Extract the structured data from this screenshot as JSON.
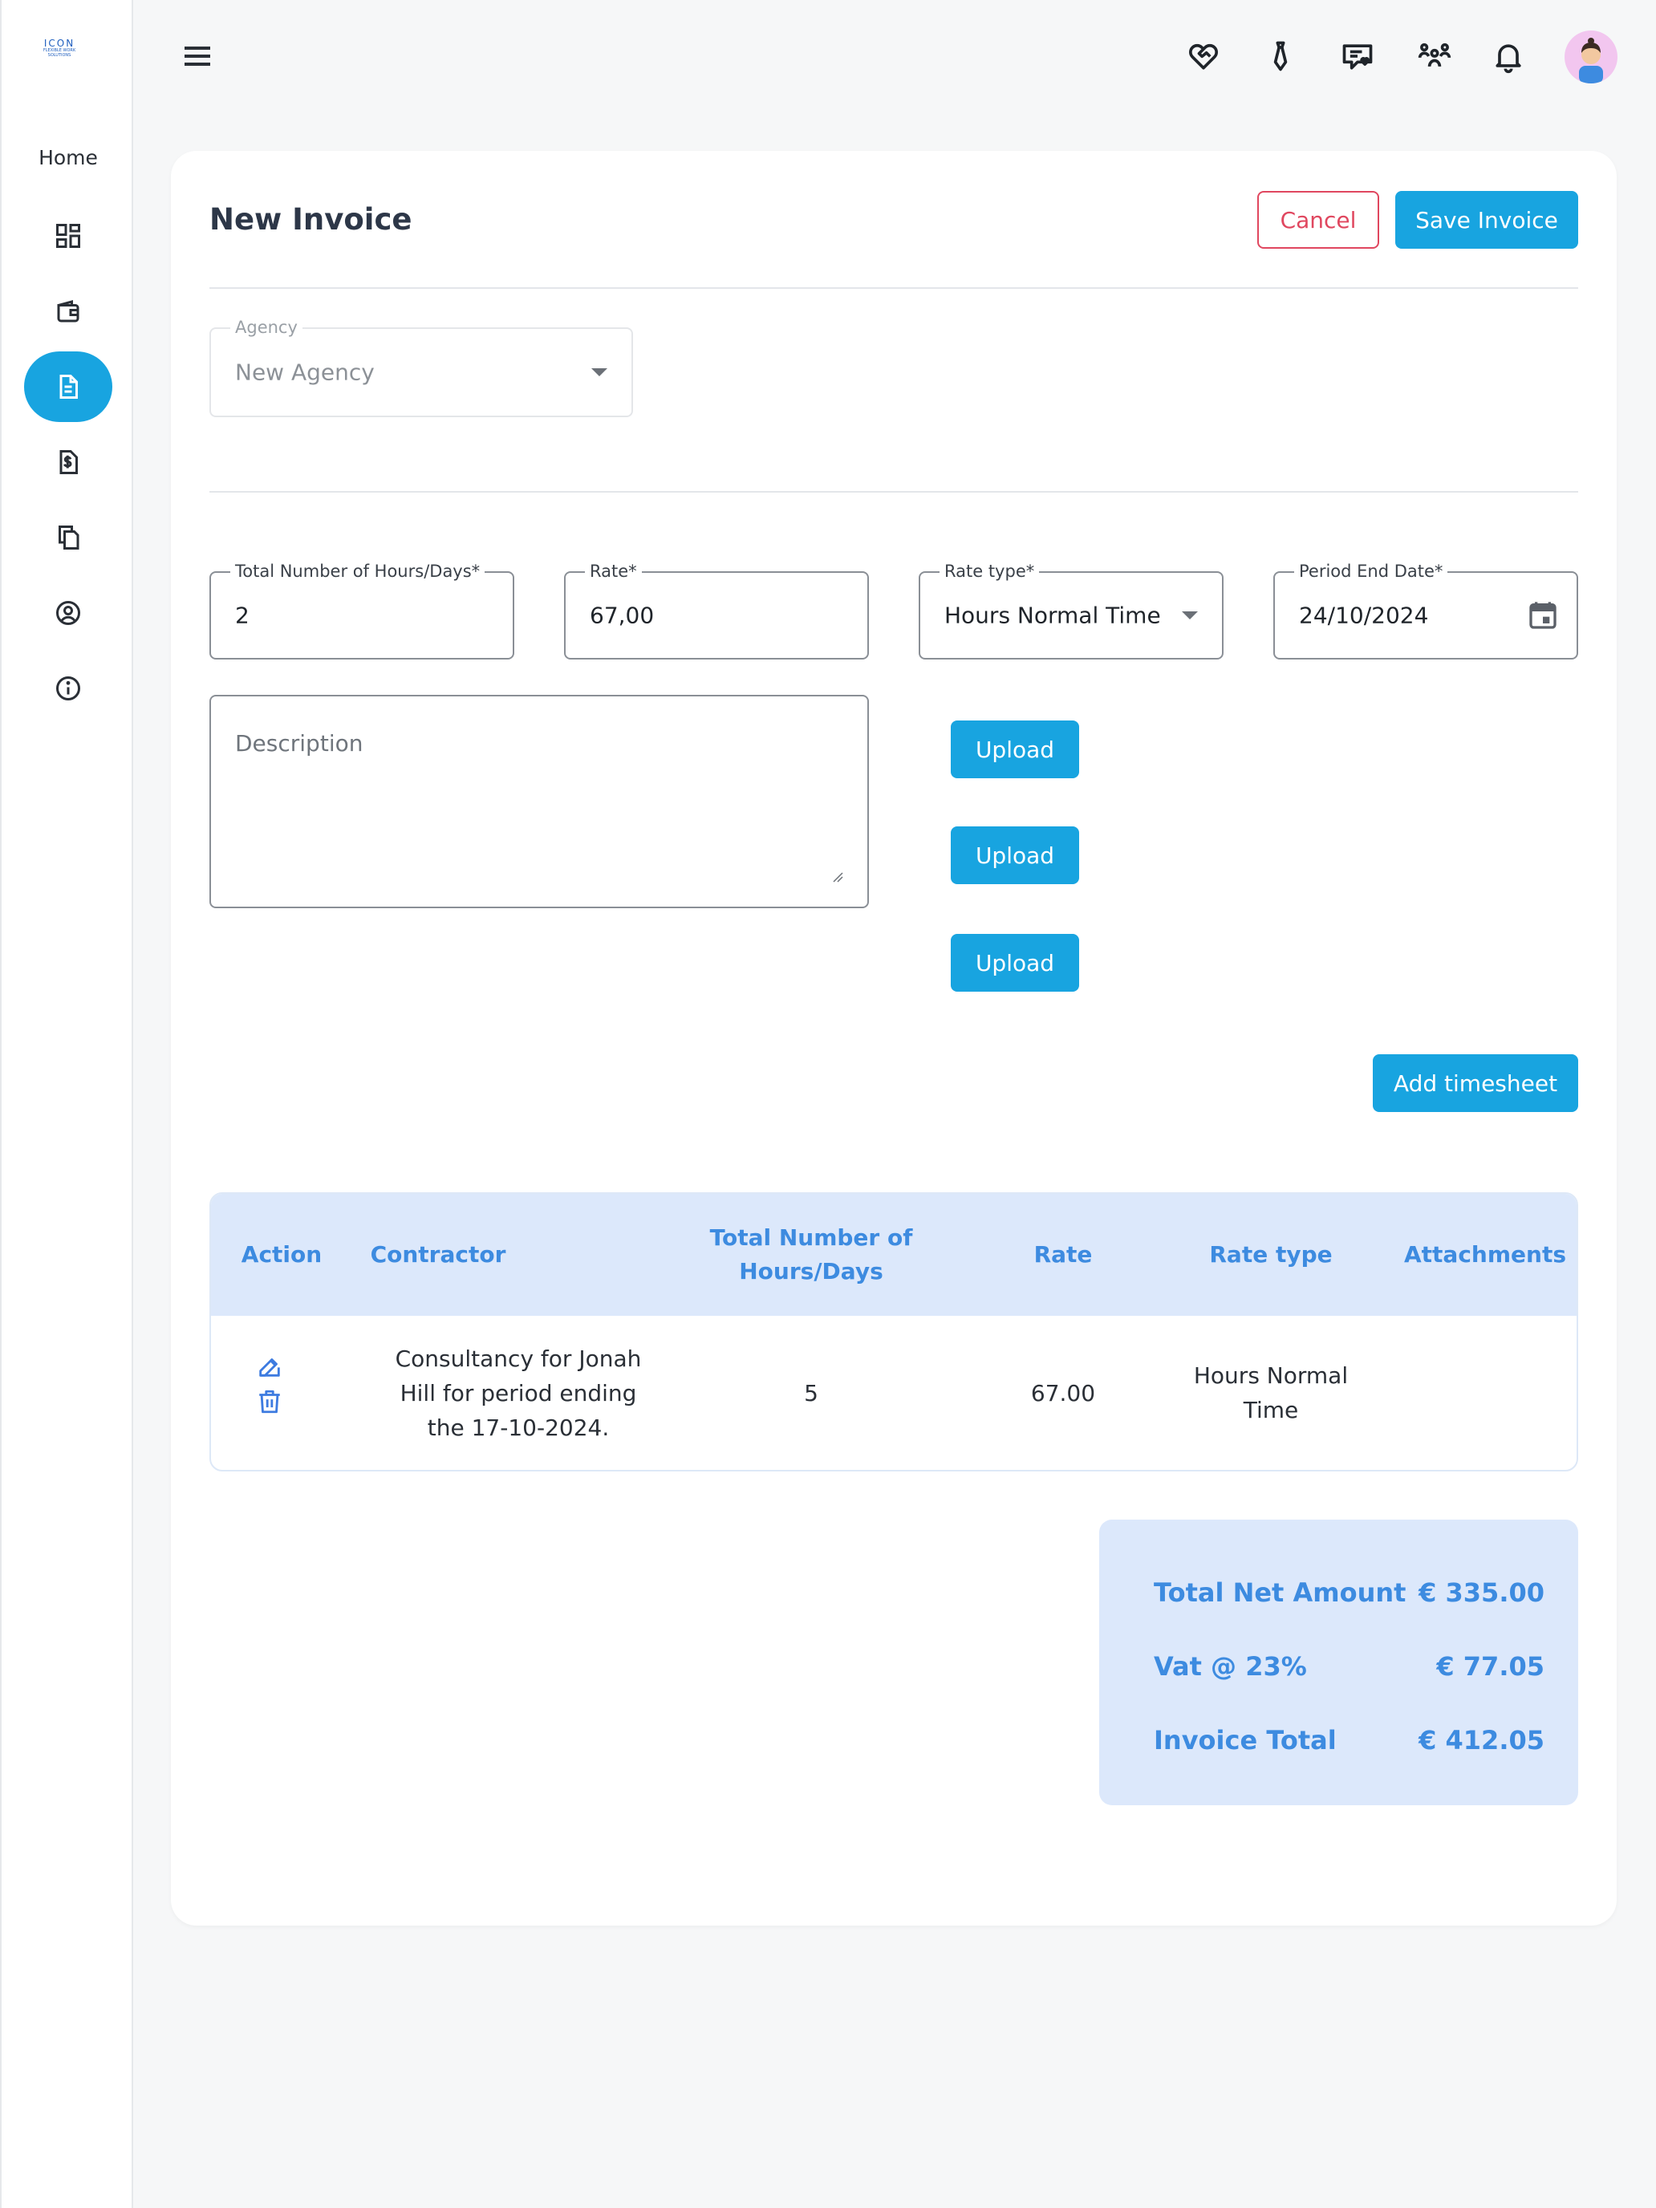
{
  "sidebar": {
    "logo_line1": "ICON",
    "logo_line2": "FLEXIBLE WORK SOLUTIONS",
    "home_label": "Home",
    "items": [
      {
        "name": "dashboard-icon",
        "active": false
      },
      {
        "name": "wallet-icon",
        "active": false
      },
      {
        "name": "invoice-icon",
        "active": true
      },
      {
        "name": "dollar-document-icon",
        "active": false
      },
      {
        "name": "copy-icon",
        "active": false
      },
      {
        "name": "user-circle-icon",
        "active": false
      },
      {
        "name": "info-icon",
        "active": false
      }
    ]
  },
  "topbar": {
    "icons": [
      "handshake-icon",
      "tie-icon",
      "chat-heart-icon",
      "team-icon",
      "bell-icon"
    ]
  },
  "form": {
    "title": "New Invoice",
    "cancel_label": "Cancel",
    "save_label": "Save Invoice",
    "agency": {
      "label": "Agency",
      "value": "New Agency"
    },
    "hours": {
      "label": "Total Number of Hours/Days*",
      "value": "2"
    },
    "rate": {
      "label": "Rate*",
      "value": "67,00"
    },
    "rate_type": {
      "label": "Rate type*",
      "value": "Hours Normal Time"
    },
    "period_end": {
      "label": "Period End Date*",
      "value": "24/10/2024"
    },
    "description_placeholder": "Description",
    "upload_labels": [
      "Upload",
      "Upload",
      "Upload"
    ],
    "add_timesheet_label": "Add timesheet"
  },
  "table": {
    "headers": {
      "action": "Action",
      "contractor": "Contractor",
      "hours_l1": "Total Number of",
      "hours_l2": "Hours/Days",
      "rate": "Rate",
      "rate_type": "Rate type",
      "attachments": "Attachments"
    },
    "rows": [
      {
        "contractor_l1": "Consultancy for Jonah",
        "contractor_l2": "Hill for period ending",
        "contractor_l3": "the 17-10-2024.",
        "hours": "5",
        "rate": "67.00",
        "rate_type_l1": "Hours Normal",
        "rate_type_l2": "Time",
        "attachments": ""
      }
    ]
  },
  "totals": {
    "net_label": "Total Net Amount",
    "net_value": "€ 335.00",
    "vat_label": "Vat @ 23%",
    "vat_value": "€ 77.05",
    "total_label": "Invoice Total",
    "total_value": "€ 412.05"
  },
  "colors": {
    "primary": "#18a4e0",
    "cancel": "#e0475f",
    "table_header_bg": "#dce8fb",
    "table_header_text": "#3d8be0"
  }
}
